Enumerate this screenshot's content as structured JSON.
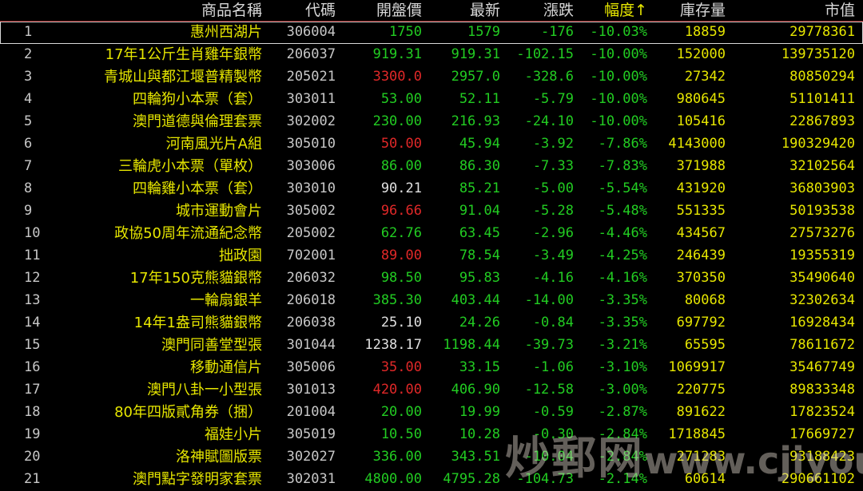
{
  "headers": {
    "name": "商品名稱",
    "code": "代碼",
    "open": "開盤價",
    "last": "最新",
    "change": "漲跌",
    "pct": "幅度↑",
    "stock": "庫存量",
    "mcap": "市值"
  },
  "colors": {
    "up": "#e02828",
    "down": "#22cc22",
    "flat": "#e0e0e0",
    "name": "#e6e600",
    "header": "#d8d8d8",
    "sorted_header": "#e8e800"
  },
  "rows": [
    {
      "idx": "1",
      "name": "惠州西湖片",
      "code": "306004",
      "open": "1750",
      "open_color": "green",
      "last": "1579",
      "change": "-176",
      "pct": "-10.03%",
      "stock": "18859",
      "mcap": "29778361"
    },
    {
      "idx": "2",
      "name": "17年1公斤生肖雞年銀幣",
      "code": "206037",
      "open": "919.31",
      "open_color": "green",
      "last": "919.31",
      "change": "-102.15",
      "pct": "-10.00%",
      "stock": "152000",
      "mcap": "139735120"
    },
    {
      "idx": "3",
      "name": "青城山與都江堰普精製幣",
      "code": "205021",
      "open": "3300.0",
      "open_color": "red",
      "last": "2957.0",
      "change": "-328.6",
      "pct": "-10.00%",
      "stock": "27342",
      "mcap": "80850294"
    },
    {
      "idx": "4",
      "name": "四輪狗小本票（套）",
      "code": "303011",
      "open": "53.00",
      "open_color": "green",
      "last": "52.11",
      "change": "-5.79",
      "pct": "-10.00%",
      "stock": "980645",
      "mcap": "51101411"
    },
    {
      "idx": "5",
      "name": "澳門道德與倫理套票",
      "code": "302002",
      "open": "230.00",
      "open_color": "green",
      "last": "216.93",
      "change": "-24.10",
      "pct": "-10.00%",
      "stock": "105416",
      "mcap": "22867893"
    },
    {
      "idx": "6",
      "name": "河南風光片A組",
      "code": "305010",
      "open": "50.00",
      "open_color": "red",
      "last": "45.94",
      "change": "-3.92",
      "pct": "-7.86%",
      "stock": "4143000",
      "mcap": "190329420"
    },
    {
      "idx": "7",
      "name": "三輪虎小本票（單枚）",
      "code": "303006",
      "open": "86.00",
      "open_color": "green",
      "last": "86.30",
      "change": "-7.33",
      "pct": "-7.83%",
      "stock": "371988",
      "mcap": "32102564"
    },
    {
      "idx": "8",
      "name": "四輪雞小本票（套）",
      "code": "303010",
      "open": "90.21",
      "open_color": "white",
      "last": "85.21",
      "change": "-5.00",
      "pct": "-5.54%",
      "stock": "431920",
      "mcap": "36803903"
    },
    {
      "idx": "9",
      "name": "城市運動會片",
      "code": "305002",
      "open": "96.66",
      "open_color": "red",
      "last": "91.04",
      "change": "-5.28",
      "pct": "-5.48%",
      "stock": "551335",
      "mcap": "50193538"
    },
    {
      "idx": "10",
      "name": "政協50周年流通紀念幣",
      "code": "205002",
      "open": "62.76",
      "open_color": "green",
      "last": "63.45",
      "change": "-2.96",
      "pct": "-4.46%",
      "stock": "434567",
      "mcap": "27573276"
    },
    {
      "idx": "11",
      "name": "拙政園",
      "code": "702001",
      "open": "89.00",
      "open_color": "red",
      "last": "78.54",
      "change": "-3.49",
      "pct": "-4.25%",
      "stock": "246439",
      "mcap": "19355319"
    },
    {
      "idx": "12",
      "name": "17年150克熊貓銀幣",
      "code": "206032",
      "open": "98.50",
      "open_color": "green",
      "last": "95.83",
      "change": "-4.16",
      "pct": "-4.16%",
      "stock": "370350",
      "mcap": "35490640"
    },
    {
      "idx": "13",
      "name": "一輪扇銀羊",
      "code": "206018",
      "open": "385.30",
      "open_color": "green",
      "last": "403.44",
      "change": "-14.00",
      "pct": "-3.35%",
      "stock": "80068",
      "mcap": "32302634"
    },
    {
      "idx": "14",
      "name": "14年1盎司熊貓銀幣",
      "code": "206038",
      "open": "25.10",
      "open_color": "white",
      "last": "24.26",
      "change": "-0.84",
      "pct": "-3.35%",
      "stock": "697792",
      "mcap": "16928434"
    },
    {
      "idx": "15",
      "name": "澳門同善堂型張",
      "code": "301044",
      "open": "1238.17",
      "open_color": "white",
      "last": "1198.44",
      "change": "-39.73",
      "pct": "-3.21%",
      "stock": "65595",
      "mcap": "78611672"
    },
    {
      "idx": "16",
      "name": "移動通信片",
      "code": "305006",
      "open": "35.00",
      "open_color": "red",
      "last": "33.15",
      "change": "-1.06",
      "pct": "-3.10%",
      "stock": "1069917",
      "mcap": "35467749"
    },
    {
      "idx": "17",
      "name": "澳門八卦一小型張",
      "code": "301013",
      "open": "420.00",
      "open_color": "red",
      "last": "406.90",
      "change": "-12.58",
      "pct": "-3.00%",
      "stock": "220775",
      "mcap": "89833348"
    },
    {
      "idx": "18",
      "name": "80年四版貳角券（捆）",
      "code": "201004",
      "open": "20.00",
      "open_color": "green",
      "last": "19.99",
      "change": "-0.59",
      "pct": "-2.87%",
      "stock": "891622",
      "mcap": "17823524"
    },
    {
      "idx": "19",
      "name": "福娃小片",
      "code": "305019",
      "open": "10.50",
      "open_color": "green",
      "last": "10.28",
      "change": "-0.30",
      "pct": "-2.84%",
      "stock": "1718845",
      "mcap": "17669727"
    },
    {
      "idx": "20",
      "name": "洛神賦圖版票",
      "code": "302027",
      "open": "336.00",
      "open_color": "green",
      "last": "343.51",
      "change": "-10.04",
      "pct": "-2.84%",
      "stock": "271283",
      "mcap": "93188423"
    },
    {
      "idx": "21",
      "name": "澳門點字發明家套票",
      "code": "302031",
      "open": "4800.00",
      "open_color": "green",
      "last": "4795.28",
      "change": "-104.73",
      "pct": "-2.14%",
      "stock": "60614",
      "mcap": "290661102"
    }
  ],
  "watermark": {
    "cn": "炒郵网",
    "en": "www.cjiyou.net"
  }
}
